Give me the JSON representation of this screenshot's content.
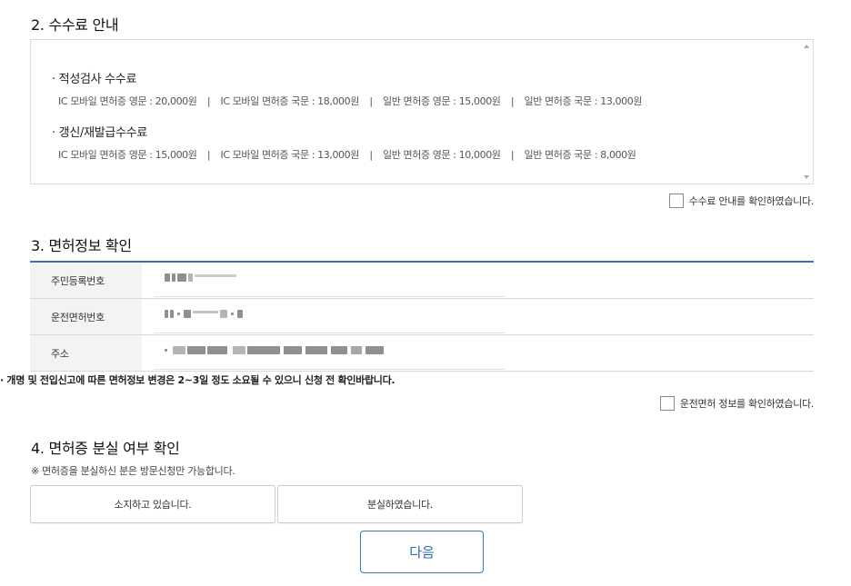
{
  "fee": {
    "title": "2. 수수료 안내",
    "groups": [
      {
        "title": "· 적성검사 수수료",
        "items": [
          "IC 모바일 면허증 영문 : 20,000원",
          "IC 모바일 면허증 국문 : 18,000원",
          "일반 면허증 영문 : 15,000원",
          "일반 면허증 국문 : 13,000원"
        ]
      },
      {
        "title": "· 갱신/재발급수수료",
        "items": [
          "IC 모바일 면허증 영문 : 15,000원",
          "IC 모바일 면허증 국문 : 13,000원",
          "일반 면허증 영문 : 10,000원",
          "일반 면허증 국문 : 8,000원"
        ]
      }
    ],
    "separator": "|",
    "confirm_label": "수수료 안내를 확인하였습니다."
  },
  "license": {
    "title": "3. 면허정보 확인",
    "rows": [
      {
        "label": "주민등록번호"
      },
      {
        "label": "운전면허번호"
      },
      {
        "label": "주소"
      }
    ],
    "note": "· 개명 및 전입신고에 따른 면허정보 변경은 2~3일 정도 소요될 수 있으니 신청 전 확인바랍니다.",
    "confirm_label": "운전면허 정보를 확인하였습니다."
  },
  "loss": {
    "title": "4. 면허증 분실 여부 확인",
    "note": "※ 면허증을 분실하신 분은 방문신청만 가능합니다.",
    "option_have": "소지하고 있습니다.",
    "option_lost": "분실하였습니다."
  },
  "next_label": "다음"
}
